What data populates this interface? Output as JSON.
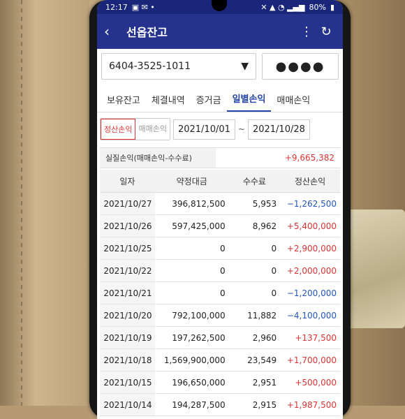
{
  "status": {
    "time": "12:17",
    "battery": "80%"
  },
  "appbar": {
    "title": "선옵잔고"
  },
  "account": {
    "number": "6404-3525-1011",
    "password_mask": "●●●●"
  },
  "tabs": [
    "보유잔고",
    "체결내역",
    "증거금",
    "일별손익",
    "매매손익"
  ],
  "filter": {
    "opt1": "정산손익",
    "opt2": "매매손익",
    "from": "2021/10/01",
    "to": "2021/10/28",
    "tilde": "~"
  },
  "summary": {
    "label": "실질손익(매매손익-수수료)",
    "value": "+9,665,382"
  },
  "table": {
    "headers": [
      "일자",
      "약정대금",
      "수수료",
      "정산손익"
    ],
    "rows": [
      {
        "date": "2021/10/27",
        "amount": "396,812,500",
        "fee": "5,953",
        "pnl": "−1,262,500",
        "sign": "neg"
      },
      {
        "date": "2021/10/26",
        "amount": "597,425,000",
        "fee": "8,962",
        "pnl": "+5,400,000",
        "sign": "pos"
      },
      {
        "date": "2021/10/25",
        "amount": "0",
        "fee": "0",
        "pnl": "+2,900,000",
        "sign": "pos"
      },
      {
        "date": "2021/10/22",
        "amount": "0",
        "fee": "0",
        "pnl": "+2,000,000",
        "sign": "pos"
      },
      {
        "date": "2021/10/21",
        "amount": "0",
        "fee": "0",
        "pnl": "−1,200,000",
        "sign": "neg"
      },
      {
        "date": "2021/10/20",
        "amount": "792,100,000",
        "fee": "11,882",
        "pnl": "−4,100,000",
        "sign": "neg"
      },
      {
        "date": "2021/10/19",
        "amount": "197,262,500",
        "fee": "2,960",
        "pnl": "+137,500",
        "sign": "pos"
      },
      {
        "date": "2021/10/18",
        "amount": "1,569,900,000",
        "fee": "23,549",
        "pnl": "+1,700,000",
        "sign": "pos"
      },
      {
        "date": "2021/10/15",
        "amount": "196,650,000",
        "fee": "2,951",
        "pnl": "+500,000",
        "sign": "pos"
      },
      {
        "date": "2021/10/14",
        "amount": "194,287,500",
        "fee": "2,915",
        "pnl": "+1,987,500",
        "sign": "pos"
      }
    ]
  }
}
